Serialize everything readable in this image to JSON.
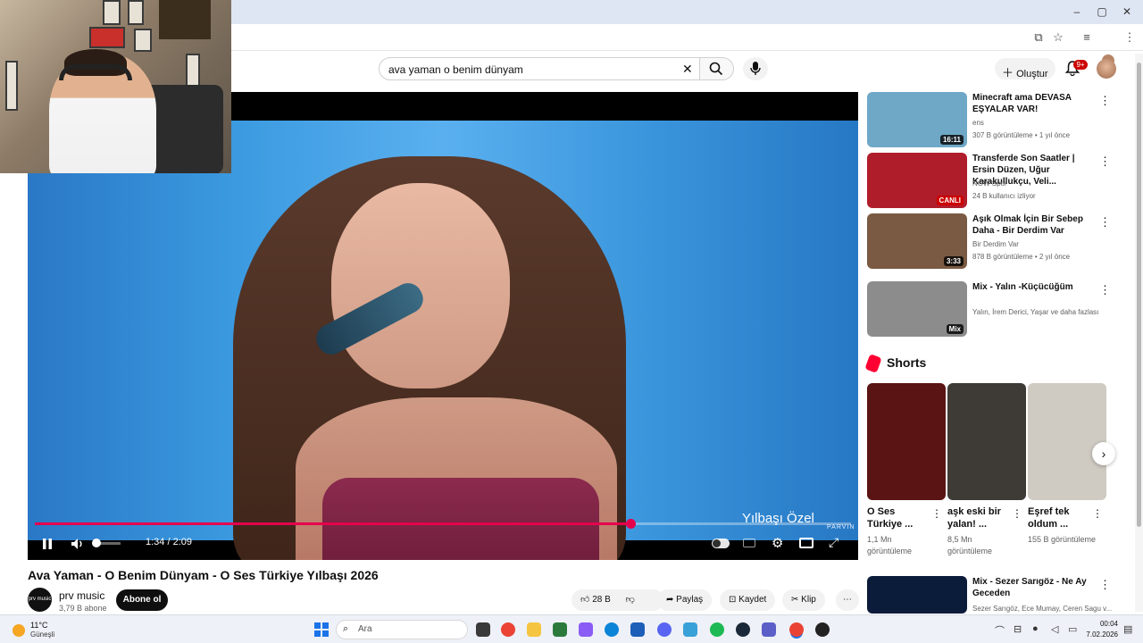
{
  "browser": {
    "window_buttons": [
      "–",
      "▢",
      "✕"
    ]
  },
  "header": {
    "search_value": "ava yaman o benim dünyam",
    "create_label": "Oluştur",
    "notif_badge": "9+"
  },
  "player": {
    "time": "1:34 / 2:09",
    "watermark": "PARVIN",
    "caption": "Yılbaşı Özel",
    "progress": 0.73
  },
  "video": {
    "title": "Ava Yaman - O Benim Dünyam - O Ses Türkiye Yılbaşı 2026",
    "channel": "prv music",
    "channel_avatar_text": "prv music",
    "subscribers": "3,79 B abone",
    "subscribe_label": "Abone ol",
    "likes": "28 B",
    "share_label": "Paylaş",
    "save_label": "Kaydet",
    "clip_label": "Klip"
  },
  "recommendations": [
    {
      "title": "Minecraft ama DEVASA EŞYALAR VAR!",
      "channel": "ens",
      "meta": "307 B görüntüleme • 1 yıl önce",
      "duration": "16:11",
      "thumb_color": "#6fa8c7"
    },
    {
      "title": "Transferde Son Saatler | Ersin Düzen, Uğur Karakullukçu, Veli...",
      "channel": "NOW Spor",
      "meta": "24 B kullanıcı izliyor",
      "duration": "CANLI",
      "thumb_color": "#b01d2a"
    },
    {
      "title": "Aşık Olmak İçin Bir Sebep Daha - Bir Derdim Var",
      "channel": "Bir Derdim Var",
      "meta": "878 B görüntüleme • 2 yıl önce",
      "duration": "3:33",
      "thumb_color": "#7a5a42"
    },
    {
      "title": "Mix - Yalın -Küçücüğüm",
      "channel": "Yalın, İrem Derici, Yaşar ve daha fazlası",
      "meta": "",
      "duration": "Mix",
      "thumb_color": "#8c8c8c"
    }
  ],
  "shorts": {
    "heading": "Shorts",
    "items": [
      {
        "title": "O Ses Türkiye ...",
        "views": "1,1 Mn görüntüleme",
        "thumb_color": "#5a1414"
      },
      {
        "title": "aşk eski bir yalan! ...",
        "views": "8,5 Mn görüntüleme",
        "thumb_color": "#3e3a36"
      },
      {
        "title": "Eşref tek oldum ...",
        "views": "155 B görüntüleme",
        "thumb_color": "#cfcac2"
      }
    ]
  },
  "rec_bottom": {
    "title": "Mix - Sezer Sarıgöz - Ne Ay Geceden",
    "channel": "Sezer Sarıgöz, Ece Mumay, Ceren Sagu v..."
  },
  "taskbar": {
    "temp": "11°C",
    "weather": "Güneşli",
    "search_placeholder": "Ara",
    "time": "00:04",
    "date": "7.02.2026"
  }
}
